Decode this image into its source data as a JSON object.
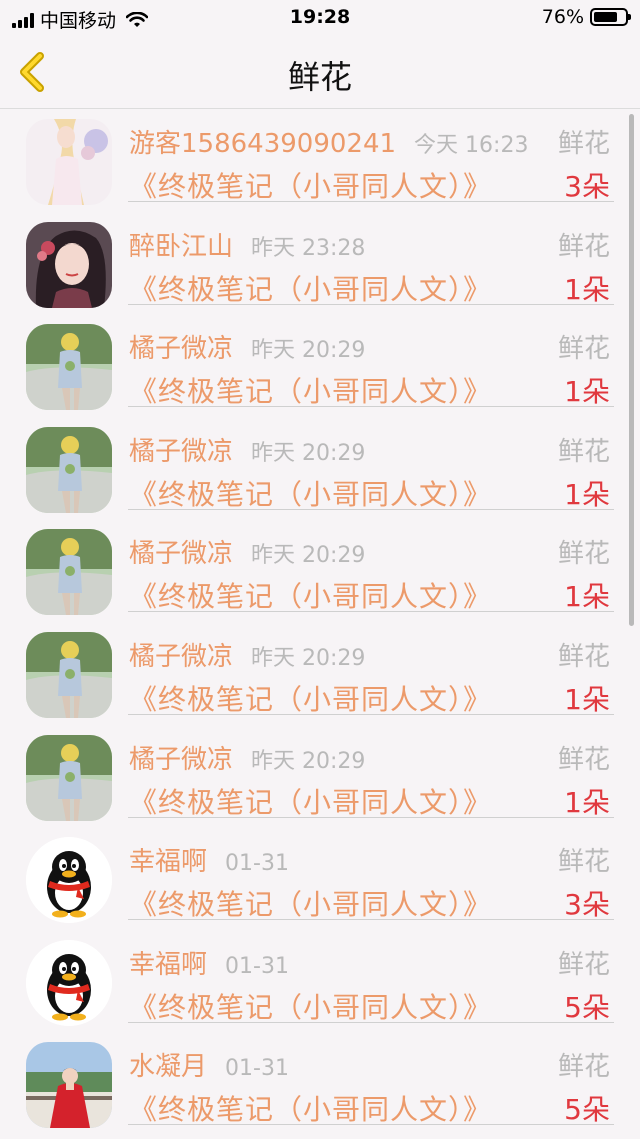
{
  "status": {
    "carrier": "中国移动",
    "time": "19:28",
    "battery": "76%",
    "battery_level": 0.76
  },
  "nav": {
    "title": "鲜花"
  },
  "rows": [
    {
      "name": "游客1586439090241",
      "time": "今天 16:23",
      "type": "鲜花",
      "book": "《终极笔记（小哥同人文）》",
      "count": "3朵",
      "avatar": "girl-angel"
    },
    {
      "name": "醉卧江山",
      "time": "昨天 23:28",
      "type": "鲜花",
      "book": "《终极笔记（小哥同人文）》",
      "count": "1朵",
      "avatar": "girl-ancient"
    },
    {
      "name": "橘子微凉",
      "time": "昨天 20:29",
      "type": "鲜花",
      "book": "《终极笔记（小哥同人文）》",
      "count": "1朵",
      "avatar": "girl-road"
    },
    {
      "name": "橘子微凉",
      "time": "昨天 20:29",
      "type": "鲜花",
      "book": "《终极笔记（小哥同人文）》",
      "count": "1朵",
      "avatar": "girl-road"
    },
    {
      "name": "橘子微凉",
      "time": "昨天 20:29",
      "type": "鲜花",
      "book": "《终极笔记（小哥同人文）》",
      "count": "1朵",
      "avatar": "girl-road"
    },
    {
      "name": "橘子微凉",
      "time": "昨天 20:29",
      "type": "鲜花",
      "book": "《终极笔记（小哥同人文）》",
      "count": "1朵",
      "avatar": "girl-road"
    },
    {
      "name": "橘子微凉",
      "time": "昨天 20:29",
      "type": "鲜花",
      "book": "《终极笔记（小哥同人文）》",
      "count": "1朵",
      "avatar": "girl-road"
    },
    {
      "name": "幸福啊",
      "time": "01-31",
      "type": "鲜花",
      "book": "《终极笔记（小哥同人文）》",
      "count": "3朵",
      "avatar": "penguin"
    },
    {
      "name": "幸福啊",
      "time": "01-31",
      "type": "鲜花",
      "book": "《终极笔记（小哥同人文）》",
      "count": "5朵",
      "avatar": "penguin"
    },
    {
      "name": "水凝月",
      "time": "01-31",
      "type": "鲜花",
      "book": "《终极笔记（小哥同人文）》",
      "count": "5朵",
      "avatar": "girl-red"
    }
  ]
}
